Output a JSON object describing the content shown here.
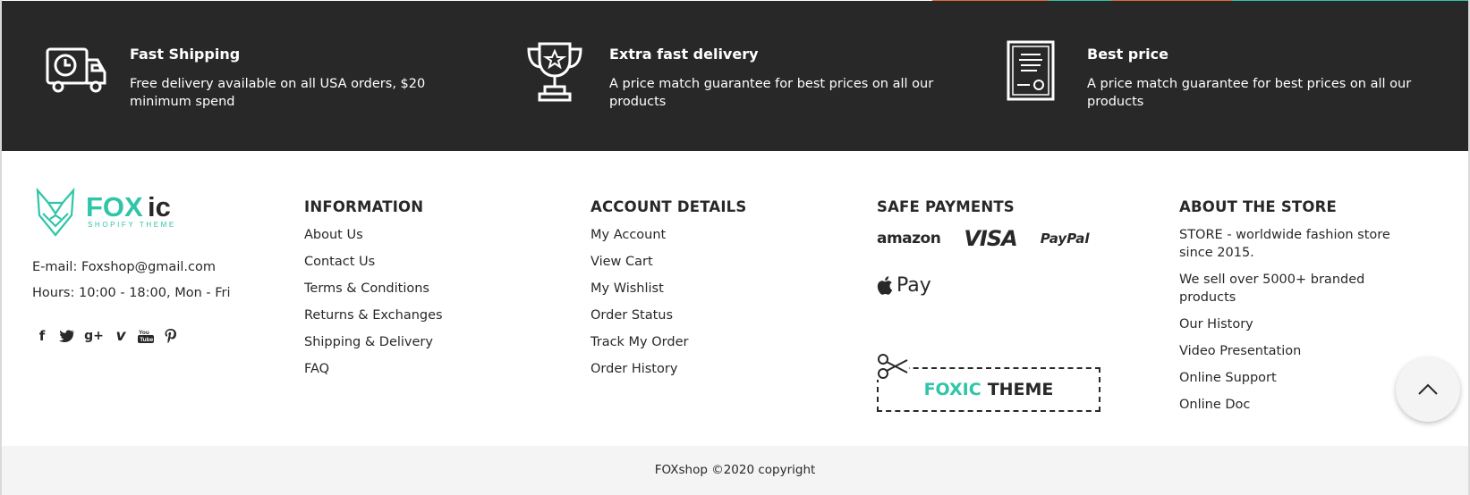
{
  "colors": {
    "dark_band": "#282828",
    "accent_teal": "#2fc5a8",
    "accent_orange": "#e46a3b"
  },
  "features": [
    {
      "icon": "delivery-truck-icon",
      "title": "Fast Shipping",
      "desc": "Free delivery available on all USA orders, $20 minimum spend"
    },
    {
      "icon": "trophy-icon",
      "title": "Extra fast delivery",
      "desc": "A price match guarantee for best prices on all our products"
    },
    {
      "icon": "certificate-icon",
      "title": "Best price",
      "desc": "A price match guarantee for best prices on all our products"
    }
  ],
  "logo": {
    "brand_main": "FOX",
    "brand_tail": "ic",
    "tagline": "SHOPIFY THEME"
  },
  "contact": {
    "email": "E-mail: Foxshop@gmail.com",
    "hours": "Hours: 10:00 - 18:00, Mon - Fri"
  },
  "social": [
    "facebook-icon",
    "twitter-icon",
    "google-plus-icon",
    "vimeo-icon",
    "youtube-icon",
    "pinterest-icon"
  ],
  "information": {
    "title": "INFORMATION",
    "links": [
      "About Us",
      "Contact Us",
      "Terms & Conditions",
      "Returns & Exchanges",
      "Shipping & Delivery",
      "FAQ"
    ]
  },
  "account": {
    "title": "ACCOUNT DETAILS",
    "links": [
      "My Account",
      "View Cart",
      "My Wishlist",
      "Order Status",
      "Track My Order",
      "Order History"
    ]
  },
  "payments": {
    "title": "SAFE PAYMENTS",
    "amazon": "amazon",
    "visa": "VISA",
    "paypal": "PayPal",
    "apple_pay": "Pay",
    "coupon_green": "FOXIC",
    "coupon_dark": "THEME"
  },
  "about": {
    "title": "ABOUT THE STORE",
    "links": [
      "STORE - worldwide fashion store since 2015.",
      "We sell over 5000+ branded products",
      "Our History",
      "Video Presentation",
      "Online Support",
      "Online Doc"
    ]
  },
  "copyright": "FOXshop ©2020 copyright"
}
